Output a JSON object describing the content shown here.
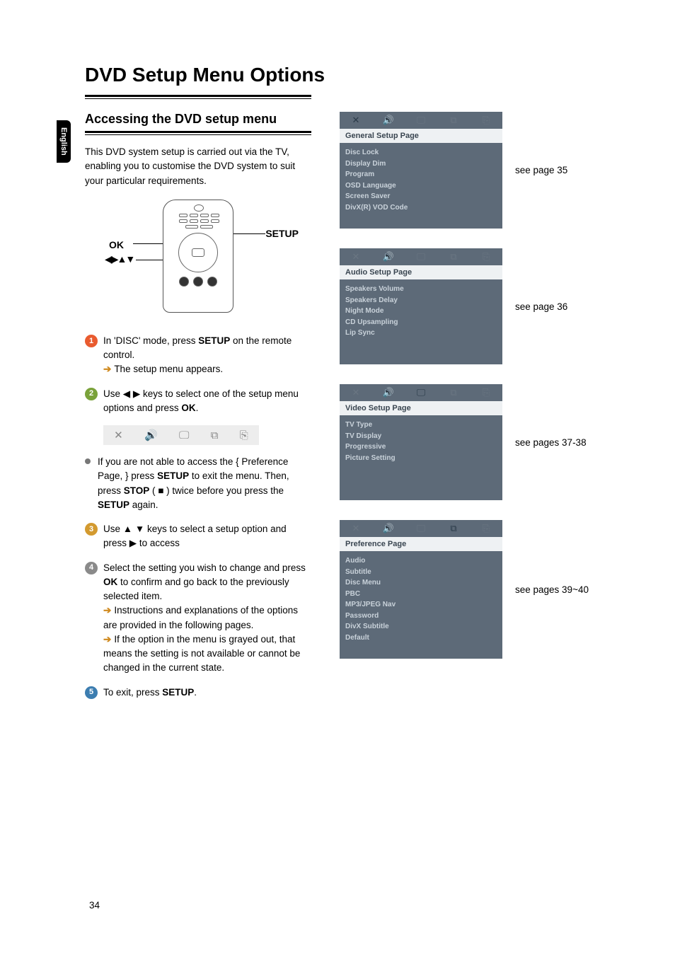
{
  "langTab": "English",
  "pageTitle": "DVD Setup Menu Options",
  "subheading": "Accessing the DVD setup menu",
  "intro": "This DVD system setup is carried out via the TV, enabling you to customise the DVD system to suit your particular requirements.",
  "remote": {
    "ok": "OK",
    "setup": "SETUP",
    "arrows": "◀▶▲▼"
  },
  "steps": {
    "s1a": "In 'DISC' mode, press ",
    "s1b": "SETUP",
    "s1c": " on the remote control.",
    "s1d": "The setup menu appears.",
    "s2a": "Use ◀ ▶ keys to select one of the setup menu options and press ",
    "s2b": "OK",
    "s2c": ".",
    "bulleta": "If you are not able to access the { Preference Page, } press ",
    "bulletb": "SETUP",
    "bulletc": " to exit the menu.  Then, press ",
    "bulletd": "STOP",
    "bullete": " ( ■ ) twice before you press the ",
    "bulletf": "SETUP",
    "bulletg": " again.",
    "s3": "Use ▲ ▼ keys to select a setup option and press ▶ to access",
    "s4a": "Select the setting you wish to change and press ",
    "s4b": "OK",
    "s4c": " to confirm and go back to the previously selected item.",
    "s4d": "Instructions and explanations of the options are provided in the following pages.",
    "s4e": "If the option in the menu is grayed out, that means the setting is not available or cannot be changed in the current state.",
    "s5a": "To exit, press ",
    "s5b": "SETUP",
    "s5c": "."
  },
  "screens": [
    {
      "title": "General Setup Page",
      "items": [
        "Disc Lock",
        "Display Dim",
        "Program",
        "OSD Language",
        "Screen Saver",
        "DivX(R) VOD Code"
      ],
      "ref": "see page 35"
    },
    {
      "title": "Audio Setup Page",
      "items": [
        "Speakers Volume",
        "Speakers Delay",
        "Night Mode",
        "CD Upsampling",
        "Lip Sync"
      ],
      "ref": "see page 36"
    },
    {
      "title": "Video Setup Page",
      "items": [
        "TV Type",
        "TV Display",
        "Progressive",
        "Picture Setting"
      ],
      "ref": "see pages 37-38"
    },
    {
      "title": "Preference Page",
      "items": [
        "Audio",
        "Subtitle",
        "Disc Menu",
        "PBC",
        "MP3/JPEG Nav",
        "Password",
        "DivX Subtitle",
        "Default"
      ],
      "ref": "see pages 39~40"
    }
  ],
  "pageNumber": "34"
}
